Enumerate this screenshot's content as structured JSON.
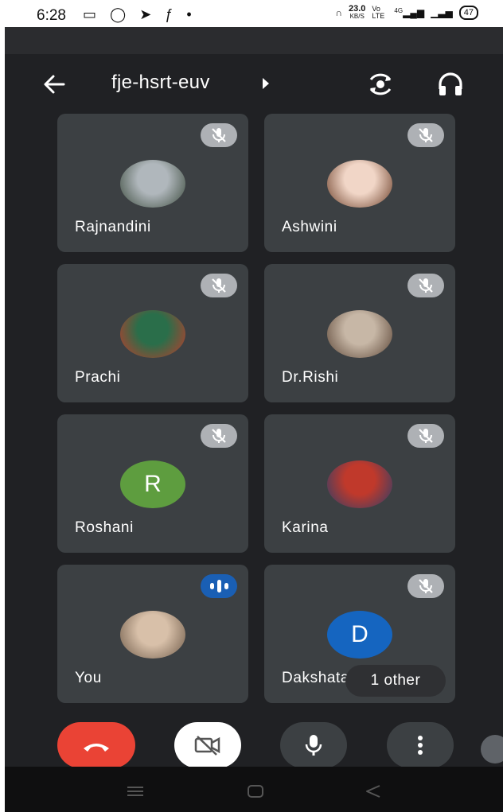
{
  "status_bar": {
    "time": "6:28",
    "speed_value": "23.0",
    "speed_unit": "KB/S",
    "network_label": "Vo LTE",
    "network_4g": "4G",
    "battery": "47"
  },
  "header": {
    "meeting_code": "fje-hsrt-euv"
  },
  "participants": [
    {
      "name": "Rajnandini",
      "muted": true,
      "avatar_type": "photo",
      "avatar_colors": [
        "#b0b7bc",
        "#3b4a3c"
      ]
    },
    {
      "name": "Ashwini",
      "muted": true,
      "avatar_type": "photo",
      "avatar_colors": [
        "#f1d6c7",
        "#6b3e28"
      ]
    },
    {
      "name": "Prachi",
      "muted": true,
      "avatar_type": "photo",
      "avatar_colors": [
        "#2a6e4a",
        "#c23a2b"
      ]
    },
    {
      "name": "Dr.Rishi",
      "muted": true,
      "avatar_type": "photo",
      "avatar_colors": [
        "#c7b7a6",
        "#5b4536"
      ]
    },
    {
      "name": "Roshani",
      "muted": true,
      "avatar_type": "letter",
      "letter": "R",
      "avatar_colors": [
        "#5e9d3f"
      ]
    },
    {
      "name": "Karina",
      "muted": true,
      "avatar_type": "photo",
      "avatar_colors": [
        "#c0392b",
        "#2a3f6b"
      ]
    },
    {
      "name": "You",
      "muted": false,
      "speaking": true,
      "avatar_type": "photo",
      "avatar_colors": [
        "#d8c0a9",
        "#6e5a48"
      ]
    },
    {
      "name": "Dakshata",
      "muted": true,
      "avatar_type": "letter",
      "letter": "D",
      "avatar_colors": [
        "#1565c0"
      ]
    }
  ],
  "others_label": "1 other",
  "controls": {
    "end_call_color": "#ea4335",
    "camera_off_bg": "#ffffff",
    "mic_bg": "#3c4043",
    "more_bg": "#3c4043"
  }
}
